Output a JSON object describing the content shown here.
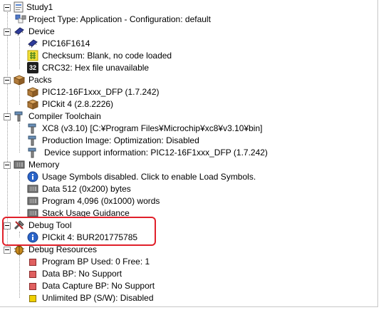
{
  "project": {
    "name": "Study1"
  },
  "rows": {
    "project_type": "Project Type: Application - Configuration: default",
    "device": "Device",
    "device_name": "PIC16F1614",
    "checksum": "Checksum: Blank, no code loaded",
    "crc32": "CRC32: Hex file unavailable",
    "crc32_badge": "32",
    "packs": "Packs",
    "pack_dfp": "PIC12-16F1xxx_DFP (1.7.242)",
    "pack_pickit": "PICkit 4 (2.8.2226)",
    "compiler_toolchain": "Compiler Toolchain",
    "xc8": "XC8 (v3.10) [C:¥Program Files¥Microchip¥xc8¥v3.10¥bin]",
    "production_image": "Production Image: Optimization: Disabled",
    "device_support": "Device support information: PIC12-16F1xxx_DFP (1.7.242)",
    "memory": "Memory",
    "usage_symbols": "Usage Symbols disabled. Click to enable Load Symbols.",
    "data_mem": "Data 512 (0x200) bytes",
    "program_mem": "Program 4,096 (0x1000) words",
    "stack_usage": "Stack Usage Guidance",
    "debug_tool": "Debug Tool",
    "pickit_serial": "PICkit 4: BUR201775785",
    "debug_resources": "Debug Resources",
    "program_bp": "Program BP Used: 0  Free: 1",
    "data_bp": "Data BP: No Support",
    "data_capture_bp": "Data Capture BP: No Support",
    "unlimited_bp": "Unlimited BP (S/W): Disabled"
  },
  "colors": {
    "highlight_border": "#e0202a",
    "info_blue": "#2a64c8",
    "bp_red": "#e06060",
    "bp_yellow": "#f0d000"
  }
}
